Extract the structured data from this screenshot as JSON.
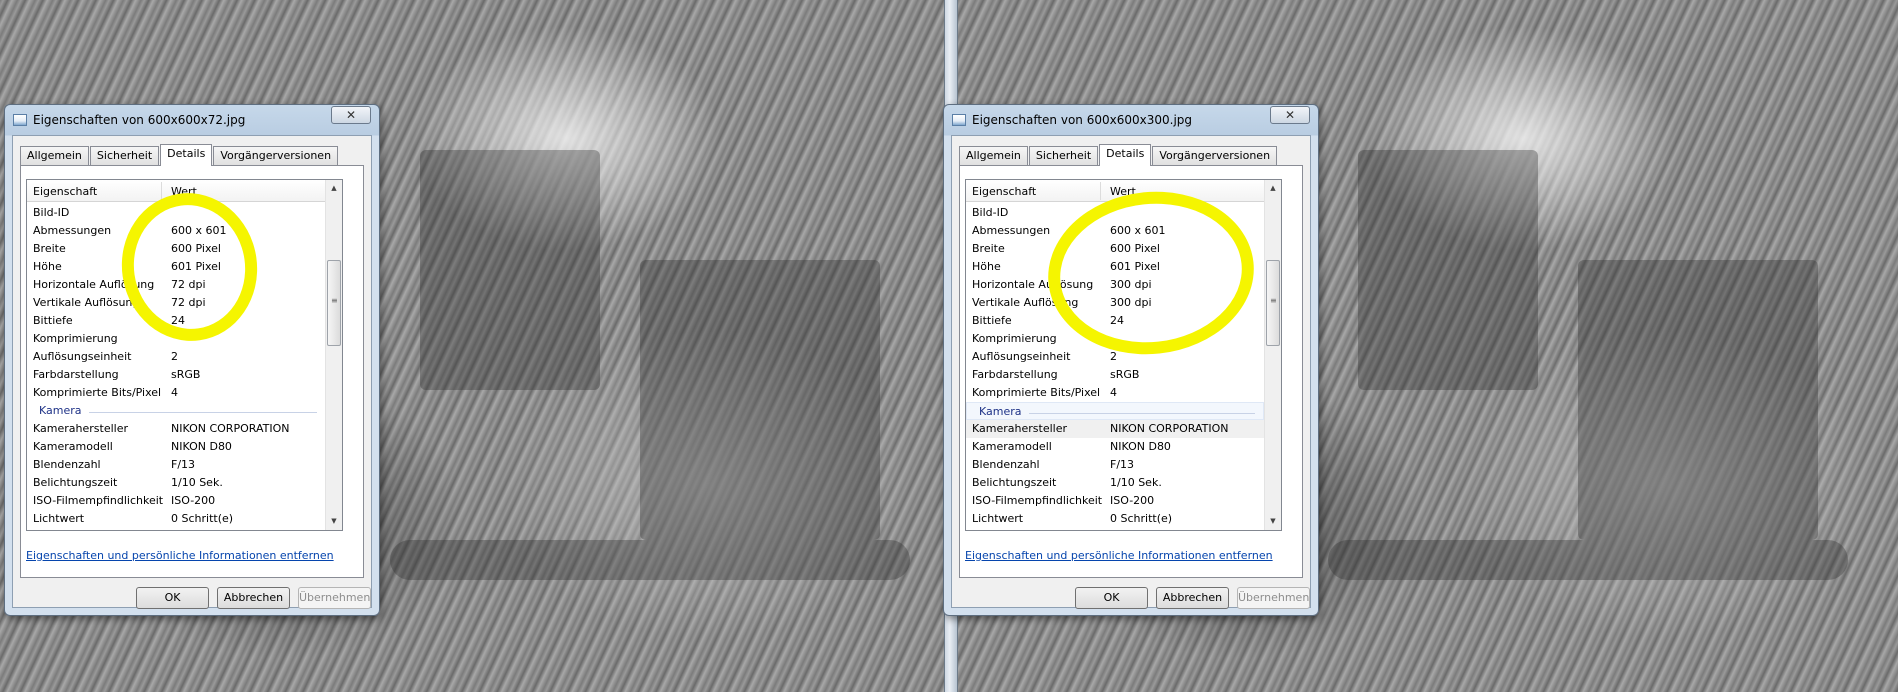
{
  "dialogs": [
    {
      "title": "Eigenschaften von 600x600x72.jpg",
      "close_glyph": "✕",
      "tabs": [
        "Allgemein",
        "Sicherheit",
        "Details",
        "Vorgängerversionen"
      ],
      "active_tab": "Details",
      "columns": {
        "property": "Eigenschaft",
        "value": "Wert"
      },
      "rows_image": [
        {
          "key": "Bild-ID",
          "value": ""
        },
        {
          "key": "Abmessungen",
          "value": "600 x 601"
        },
        {
          "key": "Breite",
          "value": "600 Pixel"
        },
        {
          "key": "Höhe",
          "value": "601 Pixel"
        },
        {
          "key": "Horizontale Auflösung",
          "value": "72 dpi"
        },
        {
          "key": "Vertikale Auflösung",
          "value": "72 dpi"
        },
        {
          "key": "Bittiefe",
          "value": "24"
        },
        {
          "key": "Komprimierung",
          "value": ""
        },
        {
          "key": "Auflösungseinheit",
          "value": "2"
        },
        {
          "key": "Farbdarstellung",
          "value": "sRGB"
        },
        {
          "key": "Komprimierte Bits/Pixel",
          "value": "4"
        }
      ],
      "group_camera": "Kamera",
      "rows_camera": [
        {
          "key": "Kamerahersteller",
          "value": "NIKON CORPORATION"
        },
        {
          "key": "Kameramodell",
          "value": "NIKON D80"
        },
        {
          "key": "Blendenzahl",
          "value": "F/13"
        },
        {
          "key": "Belichtungszeit",
          "value": "1/10 Sek."
        },
        {
          "key": "ISO-Filmempfindlichkeit",
          "value": "ISO-200"
        },
        {
          "key": "Lichtwert",
          "value": "0 Schritt(e)"
        }
      ],
      "remove_link": "Eigenschaften und persönliche Informationen entfernen",
      "buttons": {
        "ok": "OK",
        "cancel": "Abbrechen",
        "apply": "Übernehmen"
      }
    },
    {
      "title": "Eigenschaften von 600x600x300.jpg",
      "close_glyph": "✕",
      "tabs": [
        "Allgemein",
        "Sicherheit",
        "Details",
        "Vorgängerversionen"
      ],
      "active_tab": "Details",
      "columns": {
        "property": "Eigenschaft",
        "value": "Wert"
      },
      "rows_image": [
        {
          "key": "Bild-ID",
          "value": ""
        },
        {
          "key": "Abmessungen",
          "value": "600 x 601"
        },
        {
          "key": "Breite",
          "value": "600 Pixel"
        },
        {
          "key": "Höhe",
          "value": "601 Pixel"
        },
        {
          "key": "Horizontale Auflösung",
          "value": "300 dpi"
        },
        {
          "key": "Vertikale Auflösung",
          "value": "300 dpi"
        },
        {
          "key": "Bittiefe",
          "value": "24"
        },
        {
          "key": "Komprimierung",
          "value": ""
        },
        {
          "key": "Auflösungseinheit",
          "value": "2"
        },
        {
          "key": "Farbdarstellung",
          "value": "sRGB"
        },
        {
          "key": "Komprimierte Bits/Pixel",
          "value": "4"
        }
      ],
      "group_camera": "Kamera",
      "rows_camera": [
        {
          "key": "Kamerahersteller",
          "value": "NIKON CORPORATION"
        },
        {
          "key": "Kameramodell",
          "value": "NIKON D80"
        },
        {
          "key": "Blendenzahl",
          "value": "F/13"
        },
        {
          "key": "Belichtungszeit",
          "value": "1/10 Sek."
        },
        {
          "key": "ISO-Filmempfindlichkeit",
          "value": "ISO-200"
        },
        {
          "key": "Lichtwert",
          "value": "0 Schritt(e)"
        }
      ],
      "remove_link": "Eigenschaften und persönliche Informationen entfernen",
      "buttons": {
        "ok": "OK",
        "cancel": "Abbrechen",
        "apply": "Übernehmen"
      }
    }
  ],
  "colors": {
    "annotation_yellow": "#f5f500",
    "link_blue": "#0645ad",
    "group_header_blue": "#1e3287"
  },
  "icons": {
    "close": "close-icon",
    "window": "image-file-icon",
    "scroll_up": "scroll-up-arrow-icon",
    "scroll_down": "scroll-down-arrow-icon"
  }
}
